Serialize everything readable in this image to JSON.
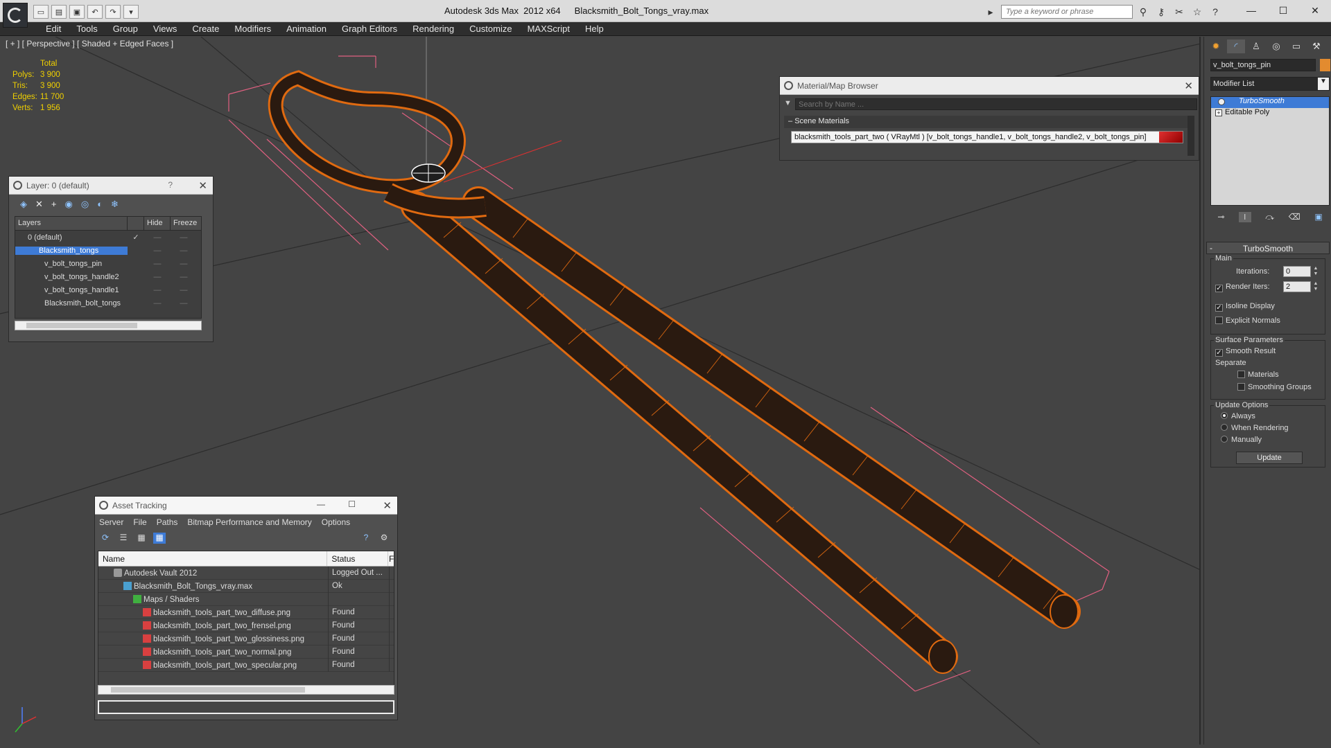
{
  "title": {
    "app": "Autodesk 3ds Max  2012 x64",
    "file": "Blacksmith_Bolt_Tongs_vray.max"
  },
  "quick_access": [
    "new",
    "open",
    "save",
    "undo",
    "redo",
    "menu"
  ],
  "info_center": {
    "placeholder": "Type a keyword or phrase"
  },
  "window_controls": {
    "minimize": "—",
    "maximize": "☐",
    "close": "✕"
  },
  "menu": [
    "Edit",
    "Tools",
    "Group",
    "Views",
    "Create",
    "Modifiers",
    "Animation",
    "Graph Editors",
    "Rendering",
    "Customize",
    "MAXScript",
    "Help"
  ],
  "viewport": {
    "label": "[ + ] [ Perspective ] [ Shaded + Edged Faces ]",
    "stats_header": "Total",
    "stats": [
      {
        "k": "Polys:",
        "v": "3 900"
      },
      {
        "k": "Tris:",
        "v": "3 900"
      },
      {
        "k": "Edges:",
        "v": "11 700"
      },
      {
        "k": "Verts:",
        "v": "1 956"
      }
    ]
  },
  "layer_panel": {
    "title": "Layer: 0 (default)",
    "help": "?",
    "close": "✕",
    "columns": [
      "Layers",
      "Hide",
      "Freeze"
    ],
    "rows": [
      {
        "name": "0 (default)",
        "check": "✓",
        "hide": "—",
        "freeze": "—"
      },
      {
        "name": "Blacksmith_tongs",
        "check": "",
        "hide": "—",
        "freeze": "—"
      },
      {
        "name": "v_bolt_tongs_pin",
        "check": "",
        "hide": "—",
        "freeze": "—"
      },
      {
        "name": "v_bolt_tongs_handle2",
        "check": "",
        "hide": "—",
        "freeze": "—"
      },
      {
        "name": "v_bolt_tongs_handle1",
        "check": "",
        "hide": "—",
        "freeze": "—"
      },
      {
        "name": "Blacksmith_bolt_tongs",
        "check": "",
        "hide": "—",
        "freeze": "—"
      }
    ]
  },
  "material_browser": {
    "title": "Material/Map Browser",
    "close": "✕",
    "search_placeholder": "Search by Name ...",
    "group": "Scene Materials",
    "item": "blacksmith_tools_part_two ( VRayMtl ) [v_bolt_tongs_handle1, v_bolt_tongs_handle2, v_bolt_tongs_pin]"
  },
  "asset_tracking": {
    "title": "Asset Tracking",
    "menu": [
      "Server",
      "File",
      "Paths",
      "Bitmap Performance and Memory",
      "Options"
    ],
    "columns": [
      "Name",
      "Status",
      "F"
    ],
    "rows": [
      {
        "name": "Autodesk Vault 2012",
        "status": "Logged Out ..."
      },
      {
        "name": "Blacksmith_Bolt_Tongs_vray.max",
        "status": "Ok"
      },
      {
        "name": "Maps / Shaders",
        "status": ""
      },
      {
        "name": "blacksmith_tools_part_two_diffuse.png",
        "status": "Found"
      },
      {
        "name": "blacksmith_tools_part_two_frensel.png",
        "status": "Found"
      },
      {
        "name": "blacksmith_tools_part_two_glossiness.png",
        "status": "Found"
      },
      {
        "name": "blacksmith_tools_part_two_normal.png",
        "status": "Found"
      },
      {
        "name": "blacksmith_tools_part_two_specular.png",
        "status": "Found"
      }
    ]
  },
  "command_panel": {
    "object_name": "v_bolt_tongs_pin",
    "object_color": "#e38b2f",
    "modifier_list": "Modifier List",
    "stack": [
      "TurboSmooth",
      "Editable Poly"
    ],
    "rollout_title": "TurboSmooth",
    "main_group": "Main",
    "iterations_label": "Iterations:",
    "iterations_value": "0",
    "render_iters_label": "Render Iters:",
    "render_iters_value": "2",
    "isoline_label": "Isoline Display",
    "explicit_normals_label": "Explicit Normals",
    "surface_group": "Surface Parameters",
    "smooth_result_label": "Smooth Result",
    "separate_label": "Separate",
    "materials_label": "Materials",
    "smoothing_groups_label": "Smoothing Groups",
    "update_group": "Update Options",
    "always_label": "Always",
    "when_rendering_label": "When Rendering",
    "manually_label": "Manually",
    "update_button": "Update"
  },
  "colors": {
    "viewport_bg": "#444444",
    "wire_orange": "#e06a10",
    "selection_blue": "#3e7bd6",
    "stats_yellow": "#f0d000",
    "gizmo_pink": "#e06080"
  }
}
